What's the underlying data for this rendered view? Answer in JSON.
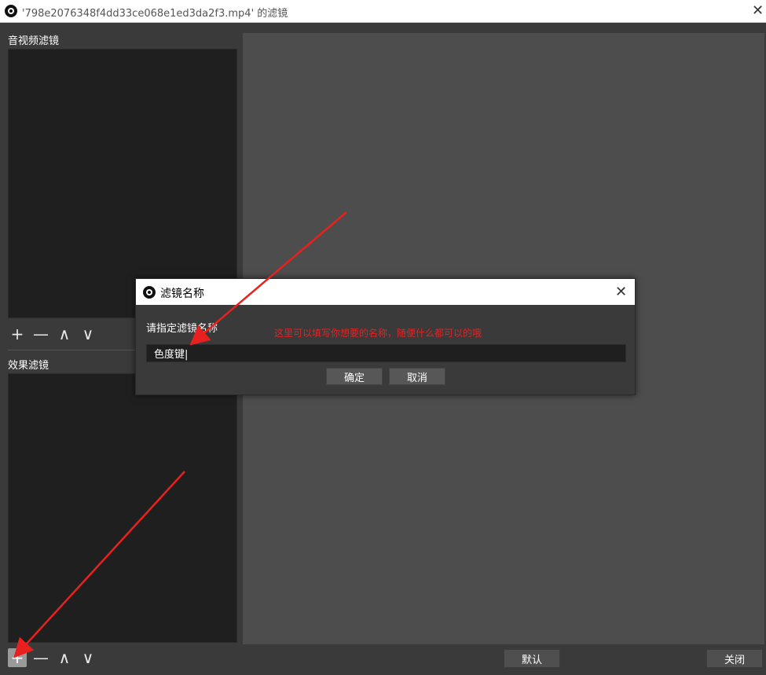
{
  "window": {
    "title": "'798e2076348f4dd33ce068e1ed3da2f3.mp4' 的滤镜",
    "close_glyph": "✕"
  },
  "audio_video_filters": {
    "label": "音视频滤镜",
    "toolbar": {
      "add": "+",
      "remove": "—",
      "up": "∧",
      "down": "∨"
    }
  },
  "effect_filters": {
    "label": "效果滤镜",
    "toolbar": {
      "add": "+",
      "remove": "—",
      "up": "∧",
      "down": "∨"
    }
  },
  "bottom": {
    "defaults_label": "默认",
    "close_label": "关闭"
  },
  "dialog": {
    "title": "滤镜名称",
    "prompt": "请指定滤镜名称",
    "input_value": "色度键|",
    "ok_label": "确定",
    "cancel_label": "取消",
    "close_glyph": "✕"
  },
  "annotation": {
    "text": "这里可以填写你想要的名称，随便什么都可以的哦",
    "color": "#e02424"
  },
  "colors": {
    "arrow": "#e8211e",
    "preview": "#4d4d4d",
    "list": "#1f1f1f"
  },
  "icons": [
    "obs-logo-icon",
    "close-icon",
    "plus-icon",
    "minus-icon",
    "chevron-up-icon",
    "chevron-down-icon",
    "arrow-annotation"
  ]
}
